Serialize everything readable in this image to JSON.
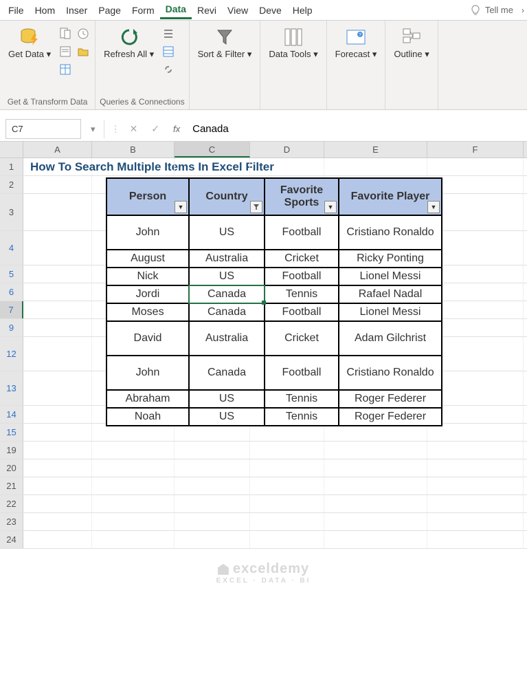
{
  "tabs": [
    "File",
    "Hom",
    "Inser",
    "Page",
    "Form",
    "Data",
    "Revi",
    "View",
    "Deve",
    "Help"
  ],
  "active_tab": 5,
  "tell_me": "Tell me",
  "ribbon": {
    "groups": [
      {
        "label": "Get & Transform Data",
        "items": [
          {
            "label": "Get\nData ▾"
          }
        ]
      },
      {
        "label": "Queries & Connections",
        "items": [
          {
            "label": "Refresh\nAll ▾"
          }
        ]
      },
      {
        "label": "",
        "items": [
          {
            "label": "Sort &\nFilter ▾"
          }
        ]
      },
      {
        "label": "",
        "items": [
          {
            "label": "Data\nTools ▾"
          }
        ]
      },
      {
        "label": "",
        "items": [
          {
            "label": "Forecast\n▾"
          }
        ]
      },
      {
        "label": "",
        "items": [
          {
            "label": "Outline\n▾"
          }
        ]
      }
    ]
  },
  "name_box": "C7",
  "formula_value": "Canada",
  "columns": [
    "A",
    "B",
    "C",
    "D",
    "E",
    "F"
  ],
  "selected_col_idx": 2,
  "title": "How To Search Multiple Items In Excel Filter",
  "row_numbers": [
    1,
    2,
    3,
    4,
    5,
    6,
    7,
    9,
    12,
    13,
    14,
    15,
    19,
    20,
    21,
    22,
    23,
    24
  ],
  "filtered_rows": [
    4,
    5,
    6,
    7,
    9,
    12,
    13,
    14,
    15
  ],
  "row_heights": {
    "3": 54,
    "4": 50,
    "12": 50,
    "13": 50
  },
  "selected_row": 7,
  "table": {
    "headers": [
      "Person",
      "Country",
      "Favorite Sports",
      "Favorite Player"
    ],
    "filter_applied_col": 1,
    "rows": [
      [
        "John",
        "US",
        "Football",
        "Cristiano Ronaldo"
      ],
      [
        "August",
        "Australia",
        "Cricket",
        "Ricky Ponting"
      ],
      [
        "Nick",
        "US",
        "Football",
        "Lionel Messi"
      ],
      [
        "Jordi",
        "Canada",
        "Tennis",
        "Rafael Nadal"
      ],
      [
        "Moses",
        "Canada",
        "Football",
        "Lionel Messi"
      ],
      [
        "David",
        "Australia",
        "Cricket",
        "Adam Gilchrist"
      ],
      [
        "John",
        "Canada",
        "Football",
        "Cristiano Ronaldo"
      ],
      [
        "Abraham",
        "US",
        "Tennis",
        "Roger Federer"
      ],
      [
        "Noah",
        "US",
        "Tennis",
        "Roger Federer"
      ]
    ],
    "tall_rows": [
      0,
      5,
      6
    ],
    "selected_cell": {
      "row": 3,
      "col": 1
    }
  },
  "watermark": {
    "main": "exceldemy",
    "sub": "EXCEL · DATA · BI"
  }
}
